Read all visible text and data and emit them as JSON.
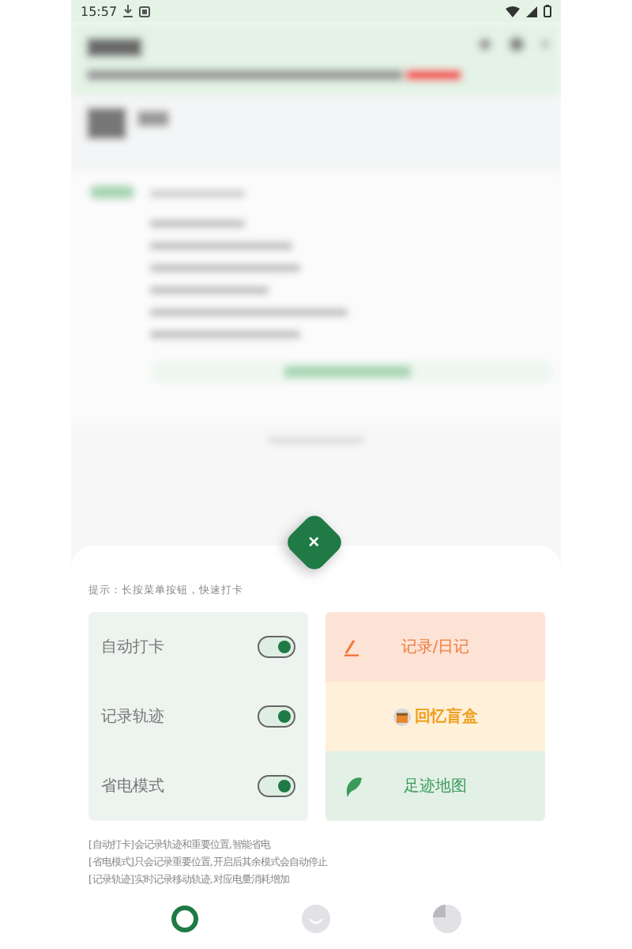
{
  "status_bar": {
    "time": "15:57"
  },
  "sheet": {
    "close": "×",
    "hint": "提示：长按菜单按钮，快速打卡",
    "toggles": [
      {
        "label": "自动打卡",
        "on": true
      },
      {
        "label": "记录轨迹",
        "on": true
      },
      {
        "label": "省电模式",
        "on": true
      }
    ],
    "actions": [
      {
        "label": "记录/日记",
        "kind": "pen",
        "color": "#f07a3a"
      },
      {
        "label": "回忆盲盒",
        "kind": "box",
        "color": "#f0a020"
      },
      {
        "label": "足迹地图",
        "kind": "leaf",
        "color": "#3a9a5a"
      }
    ],
    "notes": [
      "[自动打卡]会记录轨迹和重要位置,智能省电",
      "[省电模式]只会记录重要位置,开启后其余模式会自动停止",
      "[记录轨迹]实时记录移动轨迹,对应电量消耗增加"
    ],
    "nav": [
      {
        "kind": "ring",
        "selected": true
      },
      {
        "kind": "smile",
        "selected": false
      },
      {
        "kind": "pie",
        "selected": false
      }
    ]
  }
}
